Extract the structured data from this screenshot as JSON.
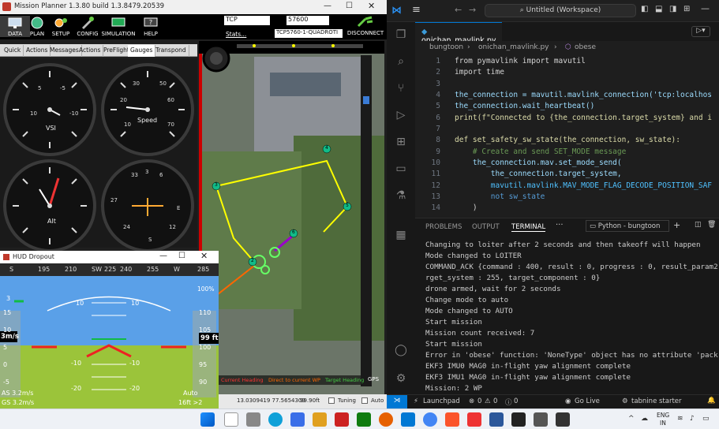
{
  "mission_planner": {
    "title": "Mission Planner 1.3.80 build 1.3.8479.20539",
    "toolbar": [
      "DATA",
      "PLAN",
      "SETUP",
      "CONFIG",
      "SIMULATION",
      "HELP"
    ],
    "port": "TCP",
    "baud": "57600",
    "stats_link": "Stats...",
    "connection": "TCP5760-1-QUADROTI",
    "disconnect": "DISCONNECT",
    "tabs": [
      "Quick",
      "Actions",
      "Messages",
      "Actions",
      "PreFlight",
      "Gauges",
      "Transpond"
    ],
    "gauges": {
      "vsi": "VSI",
      "speed": "Speed",
      "alt": "Alt"
    },
    "map": {
      "waypoints": [
        "2",
        "3",
        "4",
        "5",
        "6"
      ],
      "gps_label": "GPS",
      "legend": [
        "Current Heading",
        "Direct to current WP",
        "Target Heading"
      ],
      "coords": "13.0309419 77.5654309",
      "alt": "99.90ft",
      "tuning": "Tuning",
      "auto": "Auto"
    }
  },
  "hud": {
    "title": "HUD Dropout",
    "heading_labels": [
      "S",
      "195",
      "210",
      "SW",
      "225",
      "240",
      "255",
      "W",
      "285"
    ],
    "speed_ticks": [
      "15",
      "10",
      "5",
      "0",
      "-5"
    ],
    "alt_ticks": [
      "110",
      "105",
      "100",
      "95",
      "90"
    ],
    "pitch_labels": [
      "10",
      "10",
      "-10",
      "-10",
      "-20",
      "-20"
    ],
    "speed_value": "3m/s",
    "alt_value": "99 ft",
    "battery": "100%",
    "as_text": "AS 3.2m/s",
    "gs_text": "GS 3.2m/s",
    "mode": "Auto",
    "wp_dist": "16ft >2",
    "left_text": "3"
  },
  "vscode": {
    "search": "Untitled (Workspace)",
    "tab": "onichan_mavlink.py",
    "breadcrumb": [
      "bungtoon",
      "onichan_mavlink.py",
      "obese"
    ],
    "code": [
      {
        "n": "1",
        "t": "from pymavlink import mavutil"
      },
      {
        "n": "2",
        "t": "import time"
      },
      {
        "n": "3",
        "t": ""
      },
      {
        "n": "4",
        "t": "the_connection = mavutil.mavlink_connection('tcp:localhos"
      },
      {
        "n": "5",
        "t": "the_connection.wait_heartbeat()"
      },
      {
        "n": "6",
        "t": "print(f\"Connected to {the_connection.target_system} and i"
      },
      {
        "n": "7",
        "t": ""
      },
      {
        "n": "8",
        "t": "def set_safety_sw_state(the_connection, sw_state):"
      },
      {
        "n": "9",
        "t": "    # Create and send SET_MODE message"
      },
      {
        "n": "10",
        "t": "    the_connection.mav.set_mode_send("
      },
      {
        "n": "11",
        "t": "        the_connection.target_system,"
      },
      {
        "n": "12",
        "t": "        mavutil.mavlink.MAV_MODE_FLAG_DECODE_POSITION_SAF"
      },
      {
        "n": "13",
        "t": "        not sw_state"
      },
      {
        "n": "14",
        "t": "    )"
      }
    ],
    "panel_tabs": [
      "PROBLEMS",
      "OUTPUT",
      "TERMINAL"
    ],
    "terminal_name": "Python - bungtoon",
    "terminal": [
      "Changing to loiter after 2 seconds and then takeoff will happen",
      "Mode changed to LOITER",
      "COMMAND_ACK {command : 400, result : 0, progress : 0, result_param2",
      "rget_system : 255, target_component : 0}",
      "drone armed, wait for 2 seconds",
      "Change mode to auto",
      "Mode changed to AUTO",
      "Start mission",
      "Mission count received: 7",
      "Start mission",
      "Error in 'obese' function: 'NoneType' object has no attribute 'pack",
      "EKF3 IMU0 MAG0 in-flight yaw alignment complete",
      "EKF3 IMU1 MAG0 in-flight yaw alignment complete",
      "Mission: 2 WP"
    ],
    "status": {
      "launchpad": "Launchpad",
      "errors": "0",
      "warnings": "0",
      "info": "0",
      "golive": "Go Live",
      "tabnine": "tabnine starter"
    }
  },
  "taskbar": {
    "lang": "ENG",
    "region": "IN"
  }
}
